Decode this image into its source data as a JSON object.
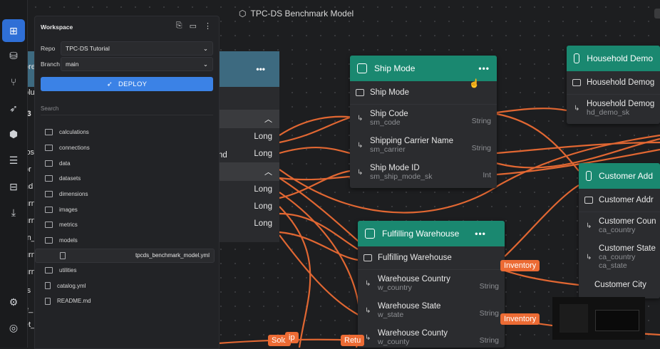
{
  "app_title": "TPC-DS Benchmark Model",
  "rail_icons": [
    "model-icon",
    "database-icon",
    "git-branch-icon",
    "rocket-icon",
    "cube-icon",
    "chat-icon",
    "tree-icon",
    "download-icon",
    "settings-icon",
    "help-icon"
  ],
  "workspace": {
    "title": "Workspace",
    "repo_label": "Repo",
    "repo_value": "TPC-DS Tutorial",
    "branch_label": "Branch",
    "branch_value": "main",
    "deploy_label": "DEPLOY",
    "search_placeholder": "Search",
    "tree": [
      {
        "name": "calculations",
        "type": "folder"
      },
      {
        "name": "connections",
        "type": "folder"
      },
      {
        "name": "data",
        "type": "folder"
      },
      {
        "name": "datasets",
        "type": "folder"
      },
      {
        "name": "dimensions",
        "type": "folder"
      },
      {
        "name": "images",
        "type": "folder"
      },
      {
        "name": "metrics",
        "type": "folder"
      },
      {
        "name": "models",
        "type": "folder"
      },
      {
        "name": "tpcds_benchmark_model.yml",
        "type": "file",
        "sub": true
      },
      {
        "name": "utilities",
        "type": "folder"
      },
      {
        "name": "catalog.yml",
        "type": "file"
      },
      {
        "name": "README.md",
        "type": "file"
      }
    ]
  },
  "left_card": {
    "more": "•••",
    "values": [
      "Long",
      "Long",
      "Long",
      "Long",
      "Long"
    ],
    "behind_text": [
      "ore",
      "olu",
      "(3",
      "los",
      "or",
      "nd",
      "urn_",
      "urn_",
      "rn_",
      "urn_",
      "urn_",
      "rs",
      "e_",
      "et_",
      "nd"
    ]
  },
  "ship_mode": {
    "title": "Ship Mode",
    "more": "•••",
    "key_field": "Ship Mode",
    "fields": [
      {
        "name": "Ship Code",
        "sub": "sm_code",
        "type": "String"
      },
      {
        "name": "Shipping Carrier Name",
        "sub": "sm_carrier",
        "type": "String"
      },
      {
        "name": "Ship Mode ID",
        "sub": "sm_ship_mode_sk",
        "type": "Int"
      }
    ]
  },
  "fulfilling_warehouse": {
    "title": "Fulfilling Warehouse",
    "more": "•••",
    "key_field": "Fulfilling Warehouse",
    "fields": [
      {
        "name": "Warehouse Country",
        "sub": "w_country",
        "type": "String"
      },
      {
        "name": "Warehouse State",
        "sub": "w_state",
        "type": "String"
      },
      {
        "name": "Warehouse County",
        "sub": "w_county",
        "type": "String"
      }
    ]
  },
  "household_demo": {
    "title": "Household Demo",
    "key_field": "Household Demog",
    "fields": [
      {
        "name": "Household Demog",
        "sub": "hd_demo_sk",
        "type": ""
      }
    ]
  },
  "customer_address": {
    "title": "Customer Add",
    "key_field": "Customer Addr",
    "fields": [
      {
        "name": "Customer Coun",
        "sub": "ca_country",
        "sub2": "",
        "type": ""
      },
      {
        "name": "Customer State",
        "sub": "ca_country",
        "sub2": "ca_state",
        "type": ""
      },
      {
        "name": "Customer City",
        "sub": "",
        "sub2": "",
        "type": ""
      }
    ]
  },
  "pills": [
    "Inventory",
    "Inventory",
    "Sold",
    "ip",
    "Retu"
  ],
  "colors": {
    "accent": "#1a8870",
    "edge": "#ec6b34",
    "deploy": "#3b82e6"
  }
}
